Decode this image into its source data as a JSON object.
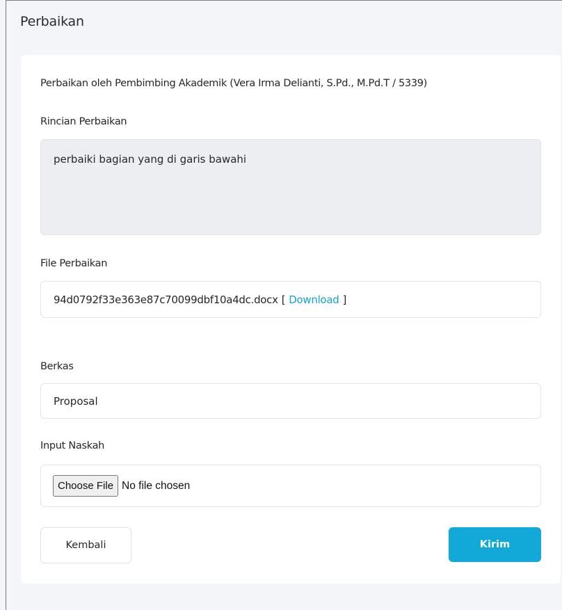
{
  "panel": {
    "title": "Perbaikan"
  },
  "form": {
    "reviewer_line": "Perbaikan oleh Pembimbing Akademik (Vera Irma Delianti, S.Pd., M.Pd.T / 5339)",
    "details_label": "Rincian Perbaikan",
    "details_value": "perbaiki bagian yang di garis bawahi",
    "file_label": "File Perbaikan",
    "file_name": "94d0792f33e363e87c70099dbf10a4dc.docx",
    "file_open_bracket": "[",
    "file_download_label": "Download",
    "file_close_bracket": "]",
    "berkas_label": "Berkas",
    "berkas_value": "Proposal",
    "upload_label": "Input Naskah",
    "upload_button_label": "Choose File",
    "upload_status": "No file chosen"
  },
  "actions": {
    "back_label": "Kembali",
    "submit_label": "Kirim"
  },
  "colors": {
    "accent": "#12a8d8",
    "link": "#13a3d6",
    "page_background": "#f4f5f8"
  }
}
